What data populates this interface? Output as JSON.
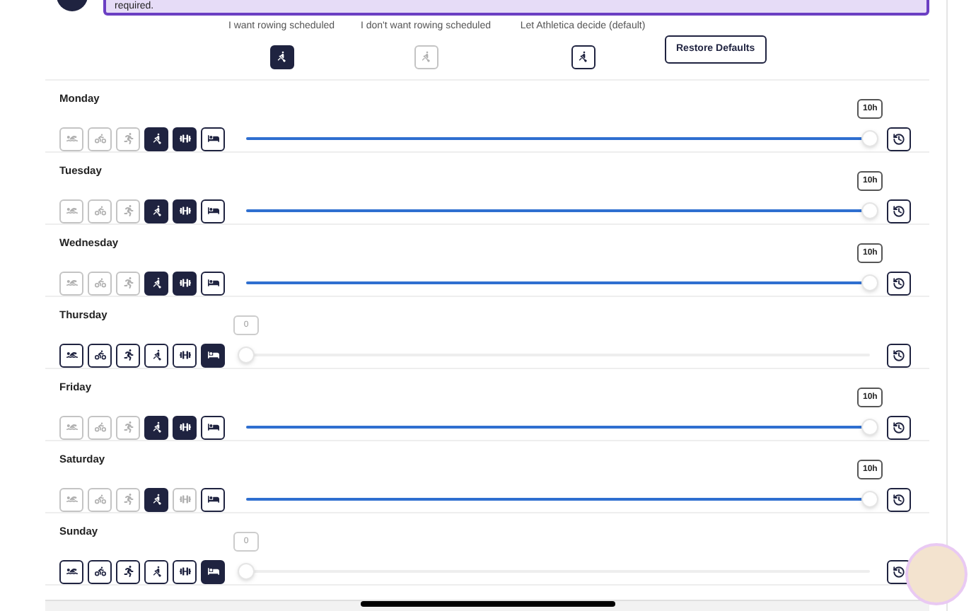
{
  "banner": {
    "text": "required."
  },
  "legend": [
    {
      "label": "I want rowing scheduled",
      "selected": true,
      "disabled": false
    },
    {
      "label": "I don't want rowing scheduled",
      "selected": false,
      "disabled": true
    },
    {
      "label": "Let Athletica decide (default)",
      "selected": false,
      "disabled": false
    }
  ],
  "restore_button": "Restore Defaults",
  "days": [
    {
      "name": "Monday",
      "activities": [
        {
          "kind": "swim",
          "selected": false,
          "disabled": true
        },
        {
          "kind": "bike",
          "selected": false,
          "disabled": true
        },
        {
          "kind": "run",
          "selected": false,
          "disabled": true
        },
        {
          "kind": "row",
          "selected": true,
          "disabled": false
        },
        {
          "kind": "strength",
          "selected": true,
          "disabled": false
        },
        {
          "kind": "rest",
          "selected": false,
          "disabled": false
        }
      ],
      "level": 1,
      "reading": "10h"
    },
    {
      "name": "Tuesday",
      "activities": [
        {
          "kind": "swim",
          "selected": false,
          "disabled": true
        },
        {
          "kind": "bike",
          "selected": false,
          "disabled": true
        },
        {
          "kind": "run",
          "selected": false,
          "disabled": true
        },
        {
          "kind": "row",
          "selected": true,
          "disabled": false
        },
        {
          "kind": "strength",
          "selected": true,
          "disabled": false
        },
        {
          "kind": "rest",
          "selected": false,
          "disabled": false
        }
      ],
      "level": 1,
      "reading": "10h"
    },
    {
      "name": "Wednesday",
      "activities": [
        {
          "kind": "swim",
          "selected": false,
          "disabled": true
        },
        {
          "kind": "bike",
          "selected": false,
          "disabled": true
        },
        {
          "kind": "run",
          "selected": false,
          "disabled": true
        },
        {
          "kind": "row",
          "selected": true,
          "disabled": false
        },
        {
          "kind": "strength",
          "selected": true,
          "disabled": false
        },
        {
          "kind": "rest",
          "selected": false,
          "disabled": false
        }
      ],
      "level": 1,
      "reading": "10h"
    },
    {
      "name": "Thursday",
      "activities": [
        {
          "kind": "swim",
          "selected": false,
          "disabled": false
        },
        {
          "kind": "bike",
          "selected": false,
          "disabled": false
        },
        {
          "kind": "run",
          "selected": false,
          "disabled": false
        },
        {
          "kind": "row",
          "selected": false,
          "disabled": false
        },
        {
          "kind": "strength",
          "selected": false,
          "disabled": false
        },
        {
          "kind": "rest",
          "selected": true,
          "disabled": false
        }
      ],
      "level": 0,
      "reading": "0"
    },
    {
      "name": "Friday",
      "activities": [
        {
          "kind": "swim",
          "selected": false,
          "disabled": true
        },
        {
          "kind": "bike",
          "selected": false,
          "disabled": true
        },
        {
          "kind": "run",
          "selected": false,
          "disabled": true
        },
        {
          "kind": "row",
          "selected": true,
          "disabled": false
        },
        {
          "kind": "strength",
          "selected": true,
          "disabled": false
        },
        {
          "kind": "rest",
          "selected": false,
          "disabled": false
        }
      ],
      "level": 1,
      "reading": "10h"
    },
    {
      "name": "Saturday",
      "activities": [
        {
          "kind": "swim",
          "selected": false,
          "disabled": true
        },
        {
          "kind": "bike",
          "selected": false,
          "disabled": true
        },
        {
          "kind": "run",
          "selected": false,
          "disabled": true
        },
        {
          "kind": "row",
          "selected": true,
          "disabled": false
        },
        {
          "kind": "strength",
          "selected": false,
          "disabled": true
        },
        {
          "kind": "rest",
          "selected": false,
          "disabled": false
        }
      ],
      "level": 1,
      "reading": "10h"
    },
    {
      "name": "Sunday",
      "activities": [
        {
          "kind": "swim",
          "selected": false,
          "disabled": false
        },
        {
          "kind": "bike",
          "selected": false,
          "disabled": false
        },
        {
          "kind": "run",
          "selected": false,
          "disabled": false
        },
        {
          "kind": "row",
          "selected": false,
          "disabled": false
        },
        {
          "kind": "strength",
          "selected": false,
          "disabled": false
        },
        {
          "kind": "rest",
          "selected": true,
          "disabled": false
        }
      ],
      "level": 0,
      "reading": "0"
    }
  ]
}
